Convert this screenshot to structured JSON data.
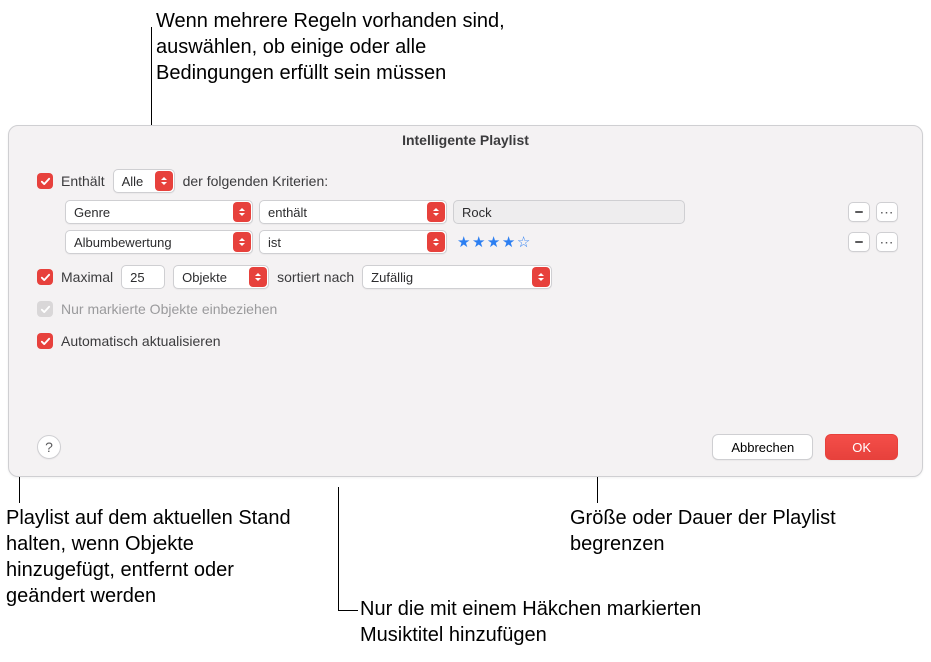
{
  "callouts": {
    "top_match": "Wenn mehrere Regeln vorhanden sind, auswählen, ob einige oder alle Bedingungen erfüllt sein müssen",
    "limit": "Größe oder Dauer der Playlist begrenzen",
    "checked_only": "Nur die mit einem Häkchen markierten Musiktitel hinzufügen",
    "live_update": "Playlist auf dem aktuellen Stand halten, wenn Objekte hinzugefügt, entfernt oder geändert werden"
  },
  "window": {
    "title": "Intelligente Playlist"
  },
  "match": {
    "label_prefix": "Enthält",
    "mode": "Alle",
    "label_suffix": "der folgenden Kriterien:"
  },
  "rules": [
    {
      "attribute": "Genre",
      "operator": "enthält",
      "value_text": "Rock",
      "value_kind": "text"
    },
    {
      "attribute": "Albumbewertung",
      "operator": "ist",
      "value_kind": "stars",
      "stars_filled": 4,
      "stars_total": 5
    }
  ],
  "limit": {
    "label": "Maximal",
    "value": "25",
    "unit": "Objekte",
    "sorted_label": "sortiert nach",
    "sorted_value": "Zufällig"
  },
  "checked_only": {
    "label": "Nur markierte Objekte einbeziehen"
  },
  "live_update": {
    "label": "Automatisch aktualisieren"
  },
  "footer": {
    "help": "?",
    "cancel": "Abbrechen",
    "ok": "OK"
  }
}
